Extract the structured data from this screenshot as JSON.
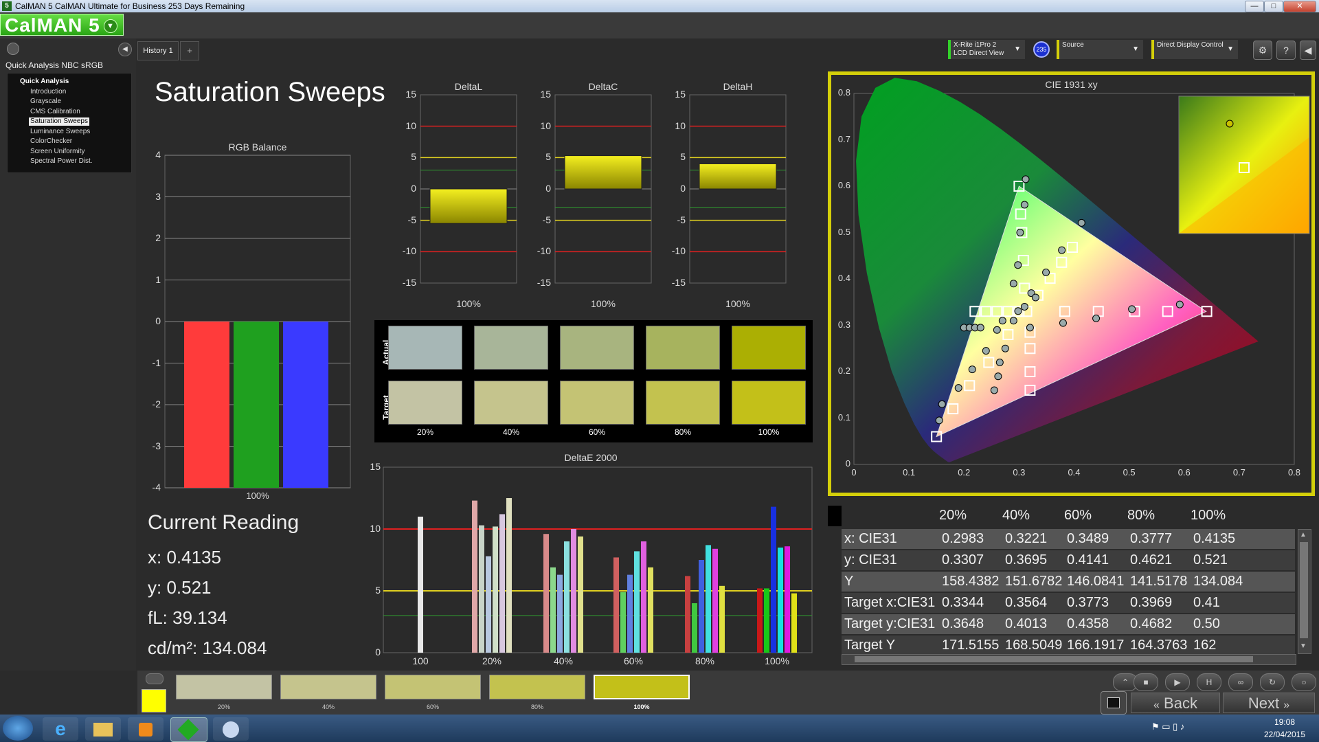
{
  "window": {
    "title": "CalMAN 5 CalMAN Ultimate for Business 253 Days Remaining",
    "app_logo": "CalMAN 5",
    "controls": {
      "minimize": "—",
      "maximize": "□",
      "close": "✕"
    }
  },
  "tabs": {
    "history": "History 1",
    "add": "+"
  },
  "toolbar": {
    "meter": {
      "line1": "X-Rite i1Pro 2",
      "line2": "LCD Direct View"
    },
    "meter_badge": "235",
    "source": "Source",
    "display": "Direct Display Control"
  },
  "sidebar": {
    "workflow_title": "Quick Analysis NBC sRGB",
    "group": "Quick Analysis",
    "items": [
      {
        "label": "Introduction"
      },
      {
        "label": "Grayscale"
      },
      {
        "label": "CMS Calibration"
      },
      {
        "label": "Saturation Sweeps",
        "selected": true
      },
      {
        "label": "Luminance Sweeps"
      },
      {
        "label": "ColorChecker"
      },
      {
        "label": "Screen Uniformity"
      },
      {
        "label": "Spectral Power Dist."
      }
    ]
  },
  "page": {
    "title": "Saturation Sweeps"
  },
  "rgb_balance": {
    "title": "RGB Balance",
    "category": "100%",
    "ticks": [
      "4",
      "3",
      "2",
      "1",
      "0",
      "-1",
      "-2",
      "-3",
      "-4"
    ],
    "values": {
      "red": -4,
      "green": -4,
      "blue": -4
    },
    "colors": {
      "red": "#ff3b3b",
      "green": "#1fa01f",
      "blue": "#3a3aff"
    }
  },
  "delta_charts": [
    {
      "title": "DeltaL",
      "category": "100%",
      "value": -5.5
    },
    {
      "title": "DeltaC",
      "category": "100%",
      "value": 5.3
    },
    {
      "title": "DeltaH",
      "category": "100%",
      "value": 4.0
    }
  ],
  "delta_ticks": [
    "15",
    "10",
    "5",
    "0",
    "-5",
    "-10",
    "-15"
  ],
  "swatches": {
    "actual_label": "Actual",
    "target_label": "Target",
    "labels": [
      "20%",
      "40%",
      "60%",
      "80%",
      "100%"
    ],
    "actual_colors": [
      "#a7b7b6",
      "#a8b599",
      "#a8b47f",
      "#a7b35e",
      "#abaf03"
    ],
    "target_colors": [
      "#c3c3a4",
      "#c5c48d",
      "#c4c374",
      "#c3c24f",
      "#c3c019"
    ]
  },
  "deltae": {
    "title": "DeltaE 2000",
    "ticks": [
      "15",
      "10",
      "5",
      "0"
    ],
    "categories": [
      "100",
      "20%",
      "40%",
      "60%",
      "80%",
      "100%"
    ]
  },
  "chart_data": {
    "type": "bar",
    "title": "DeltaE 2000",
    "categories": [
      "100",
      "20%",
      "40%",
      "60%",
      "80%",
      "100%"
    ],
    "ylim": [
      0,
      15
    ],
    "reference_lines": [
      10,
      5,
      3
    ],
    "groups": [
      {
        "category": "100",
        "values": [
          11.0
        ],
        "colors": [
          "#e8e8e8"
        ]
      },
      {
        "category": "20%",
        "values": [
          12.3,
          10.3,
          7.8,
          10.2,
          11.2,
          12.5
        ],
        "colors": [
          "#e0a8a8",
          "#c8d4c8",
          "#b8c8e0",
          "#d0e0c8",
          "#d8c8e0",
          "#e0e0c0"
        ]
      },
      {
        "category": "40%",
        "values": [
          9.6,
          6.9,
          6.3,
          9.0,
          10.0,
          9.4
        ],
        "colors": [
          "#d88a8a",
          "#8cd88c",
          "#8ca8e0",
          "#8ce0e0",
          "#e08ce0",
          "#e0e08c"
        ]
      },
      {
        "category": "60%",
        "values": [
          7.7,
          4.9,
          6.3,
          8.2,
          9.0,
          6.9
        ],
        "colors": [
          "#d06060",
          "#60d060",
          "#6080e0",
          "#60e0e0",
          "#e060e0",
          "#e0e060"
        ]
      },
      {
        "category": "80%",
        "values": [
          6.2,
          4.0,
          7.5,
          8.7,
          8.4,
          5.4
        ],
        "colors": [
          "#c84040",
          "#40c840",
          "#4060e0",
          "#40e0e0",
          "#e040e0",
          "#e0e040"
        ]
      },
      {
        "category": "100%",
        "values": [
          5.2,
          5.2,
          11.8,
          8.5,
          8.6,
          4.8
        ],
        "colors": [
          "#c81818",
          "#18c818",
          "#1830e0",
          "#18e0e0",
          "#e018e0",
          "#e0e018"
        ]
      }
    ]
  },
  "current_reading": {
    "title": "Current Reading",
    "x": "x: 0.4135",
    "y": "y: 0.521",
    "fl": "fL: 39.134",
    "cdm2": "cd/m²: 134.084"
  },
  "cie": {
    "title": "CIE 1931 xy",
    "xticks": [
      "0",
      "0.1",
      "0.2",
      "0.3",
      "0.4",
      "0.5",
      "0.6",
      "0.7",
      "0.8"
    ],
    "yticks": [
      "0",
      "0.1",
      "0.2",
      "0.3",
      "0.4",
      "0.5",
      "0.6",
      "0.7",
      "0.8"
    ],
    "gamut": {
      "red": [
        0.64,
        0.33
      ],
      "green": [
        0.3,
        0.6
      ],
      "blue": [
        0.15,
        0.06
      ]
    },
    "white": [
      0.3127,
      0.329
    ],
    "frame_color": "#d4cf0a",
    "targets": [
      [
        0.641,
        0.33
      ],
      [
        0.57,
        0.33
      ],
      [
        0.51,
        0.33
      ],
      [
        0.444,
        0.33
      ],
      [
        0.383,
        0.33
      ],
      [
        0.314,
        0.33
      ],
      [
        0.3,
        0.33
      ],
      [
        0.28,
        0.33
      ],
      [
        0.26,
        0.33
      ],
      [
        0.24,
        0.33
      ],
      [
        0.22,
        0.33
      ],
      [
        0.3,
        0.6
      ],
      [
        0.303,
        0.54
      ],
      [
        0.305,
        0.5
      ],
      [
        0.308,
        0.44
      ],
      [
        0.31,
        0.38
      ],
      [
        0.15,
        0.06
      ],
      [
        0.18,
        0.12
      ],
      [
        0.21,
        0.17
      ],
      [
        0.245,
        0.22
      ],
      [
        0.28,
        0.28
      ],
      [
        0.32,
        0.16
      ],
      [
        0.32,
        0.2
      ],
      [
        0.32,
        0.25
      ],
      [
        0.32,
        0.285
      ],
      [
        0.3969,
        0.4682
      ],
      [
        0.3773,
        0.4358
      ],
      [
        0.3564,
        0.4013
      ],
      [
        0.3344,
        0.3648
      ]
    ],
    "measured": [
      [
        0.592,
        0.345
      ],
      [
        0.505,
        0.335
      ],
      [
        0.44,
        0.315
      ],
      [
        0.38,
        0.305
      ],
      [
        0.312,
        0.615
      ],
      [
        0.31,
        0.56
      ],
      [
        0.302,
        0.5
      ],
      [
        0.298,
        0.43
      ],
      [
        0.29,
        0.39
      ],
      [
        0.16,
        0.13
      ],
      [
        0.19,
        0.165
      ],
      [
        0.215,
        0.205
      ],
      [
        0.24,
        0.245
      ],
      [
        0.26,
        0.29
      ],
      [
        0.255,
        0.16
      ],
      [
        0.262,
        0.19
      ],
      [
        0.265,
        0.22
      ],
      [
        0.275,
        0.25
      ],
      [
        0.29,
        0.31
      ],
      [
        0.155,
        0.095
      ],
      [
        0.2,
        0.295
      ],
      [
        0.21,
        0.295
      ],
      [
        0.22,
        0.295
      ],
      [
        0.23,
        0.295
      ],
      [
        0.4135,
        0.521
      ],
      [
        0.3777,
        0.4621
      ],
      [
        0.3489,
        0.4141
      ],
      [
        0.3221,
        0.3695
      ],
      [
        0.2983,
        0.3307
      ],
      [
        0.27,
        0.31
      ],
      [
        0.31,
        0.34
      ],
      [
        0.33,
        0.36
      ],
      [
        0.32,
        0.295
      ]
    ],
    "inset": {
      "measured": [
        0.4135,
        0.521
      ],
      "target": [
        0.3969,
        0.4682
      ]
    }
  },
  "table": {
    "header": [
      "",
      "20%",
      "40%",
      "60%",
      "80%",
      "100%"
    ],
    "rows": [
      [
        "x: CIE31",
        "0.2983",
        "0.3221",
        "0.3489",
        "0.3777",
        "0.4135"
      ],
      [
        "y: CIE31",
        "0.3307",
        "0.3695",
        "0.4141",
        "0.4621",
        "0.521"
      ],
      [
        "Y",
        "158.4382",
        "151.6782",
        "146.0841",
        "141.5178",
        "134.084"
      ],
      [
        "Target x:CIE31",
        "0.3344",
        "0.3564",
        "0.3773",
        "0.3969",
        "0.41"
      ],
      [
        "Target y:CIE31",
        "0.3648",
        "0.4013",
        "0.4358",
        "0.4682",
        "0.50"
      ],
      [
        "Target Y",
        "171.5155",
        "168.5049",
        "166.1917",
        "164.3763",
        "162"
      ]
    ]
  },
  "bottom": {
    "current_color": "#ffff00",
    "swatches": [
      {
        "label": "20%",
        "color": "#c3c3a4"
      },
      {
        "label": "40%",
        "color": "#c5c48d"
      },
      {
        "label": "60%",
        "color": "#c4c374"
      },
      {
        "label": "80%",
        "color": "#c3c24f"
      },
      {
        "label": "100%",
        "color": "#c3c019"
      }
    ],
    "back": "Back",
    "next": "Next"
  },
  "taskbar": {
    "time": "19:08",
    "date": "22/04/2015"
  }
}
